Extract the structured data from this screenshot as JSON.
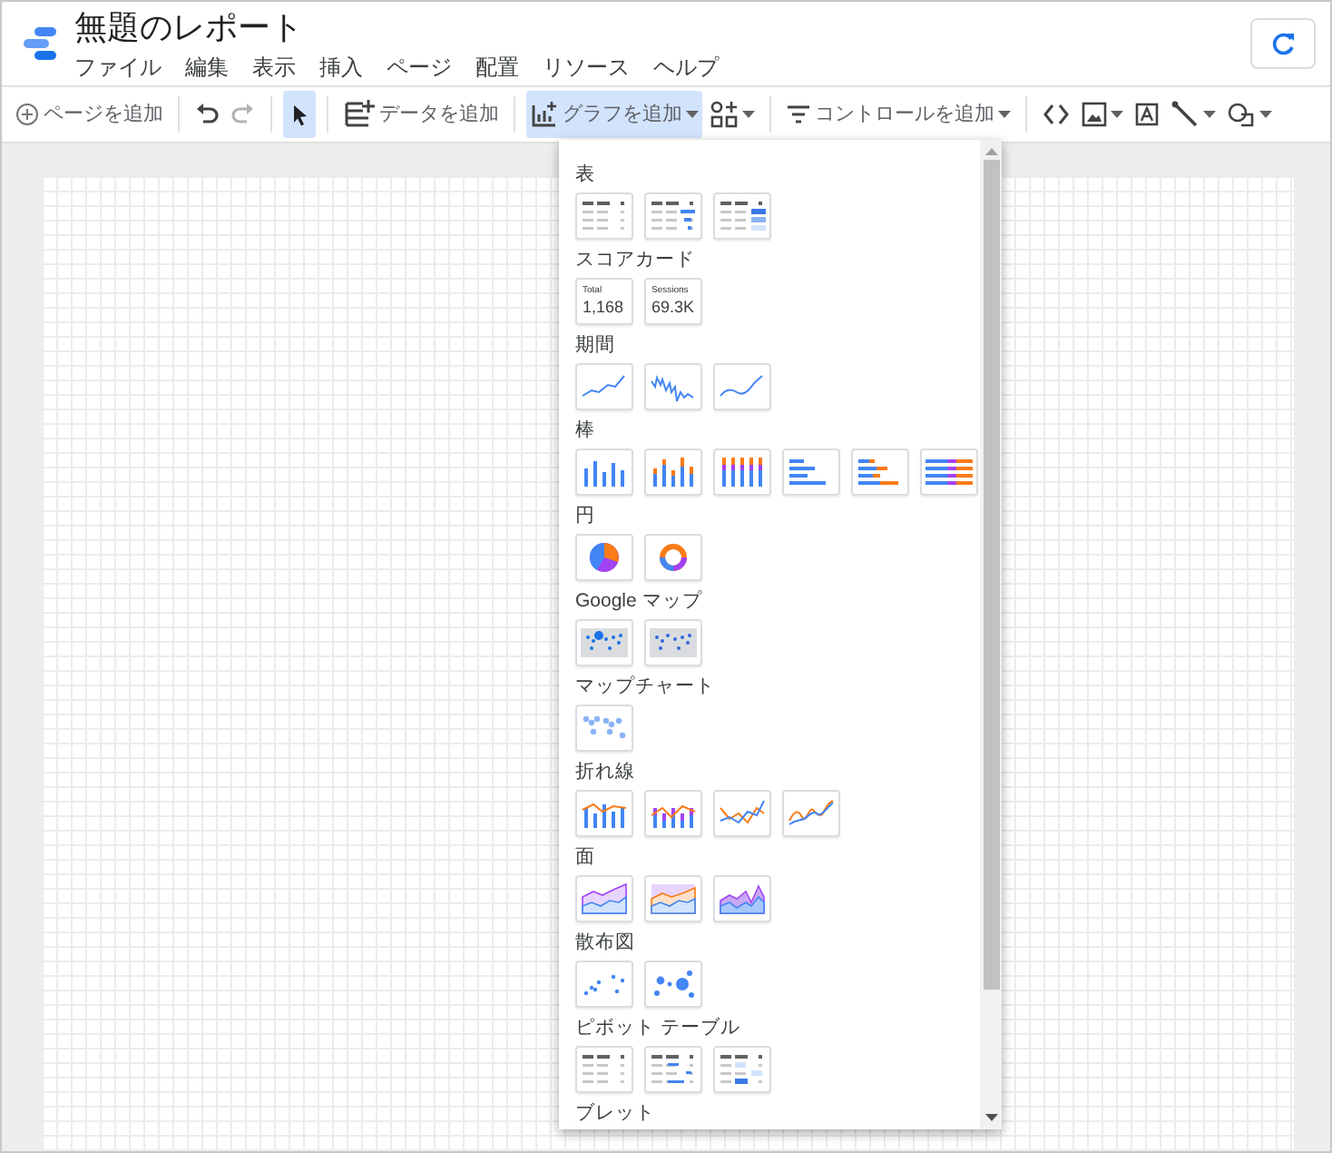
{
  "header": {
    "title": "無題のレポート",
    "menu": [
      "ファイル",
      "編集",
      "表示",
      "挿入",
      "ページ",
      "配置",
      "リソース",
      "ヘルプ"
    ]
  },
  "toolbar": [
    {
      "kind": "page",
      "label": "ページを追加",
      "selected": false,
      "disabled": false,
      "dropdown": false
    },
    {
      "kind": "undo",
      "selected": false,
      "disabled": false,
      "dropdown": false
    },
    {
      "kind": "redo",
      "selected": false,
      "disabled": true,
      "dropdown": false
    },
    {
      "kind": "pointer",
      "selected": true,
      "disabled": false,
      "dropdown": false
    },
    {
      "kind": "data",
      "label": "データを追加",
      "selected": false,
      "disabled": false,
      "dropdown": false
    },
    {
      "kind": "chart",
      "label": "グラフを追加",
      "selected": true,
      "disabled": false,
      "dropdown": true
    },
    {
      "kind": "community",
      "selected": false,
      "disabled": false,
      "dropdown": true
    },
    {
      "kind": "control",
      "label": "コントロールを追加",
      "selected": false,
      "disabled": false,
      "dropdown": true
    },
    {
      "kind": "embed",
      "selected": false,
      "disabled": false,
      "dropdown": false
    },
    {
      "kind": "image",
      "selected": false,
      "disabled": false,
      "dropdown": true
    },
    {
      "kind": "text",
      "selected": false,
      "disabled": false,
      "dropdown": false
    },
    {
      "kind": "line",
      "selected": false,
      "disabled": false,
      "dropdown": true
    },
    {
      "kind": "shape",
      "selected": false,
      "disabled": false,
      "dropdown": true
    }
  ],
  "chart_menu": {
    "sections": [
      {
        "label": "表",
        "options": [
          {
            "kind": "table"
          },
          {
            "kind": "tablebar"
          },
          {
            "kind": "heatmap"
          }
        ]
      },
      {
        "label": "スコアカード",
        "options": [
          {
            "kind": "scorecard",
            "caption": "Total",
            "value": "1,168"
          },
          {
            "kind": "scorecard",
            "caption": "Sessions",
            "value": "69.3K"
          }
        ]
      },
      {
        "label": "期間",
        "options": [
          {
            "kind": "trend"
          },
          {
            "kind": "noisy"
          },
          {
            "kind": "smooth"
          }
        ]
      },
      {
        "label": "棒",
        "options": [
          {
            "kind": "column"
          },
          {
            "kind": "stackedcolumn"
          },
          {
            "kind": "fullcolumn"
          },
          {
            "kind": "bar"
          },
          {
            "kind": "stackedbar"
          },
          {
            "kind": "fullbar"
          }
        ]
      },
      {
        "label": "円",
        "options": [
          {
            "kind": "pie"
          },
          {
            "kind": "donut"
          }
        ]
      },
      {
        "label": "Google マップ",
        "options": [
          {
            "kind": "bubblemap"
          },
          {
            "kind": "filledmap"
          }
        ]
      },
      {
        "label": "マップチャート",
        "options": [
          {
            "kind": "geomap"
          }
        ]
      },
      {
        "label": "折れ線",
        "options": [
          {
            "kind": "combo"
          },
          {
            "kind": "stackedcombo"
          },
          {
            "kind": "line"
          },
          {
            "kind": "smoothline"
          }
        ]
      },
      {
        "label": "面",
        "options": [
          {
            "kind": "area"
          },
          {
            "kind": "stackedarea"
          },
          {
            "kind": "fullarea"
          }
        ]
      },
      {
        "label": "散布図",
        "options": [
          {
            "kind": "scatter"
          },
          {
            "kind": "bubble"
          }
        ]
      },
      {
        "label": "ピボット テーブル",
        "options": [
          {
            "kind": "pivot"
          },
          {
            "kind": "pivotbar"
          },
          {
            "kind": "pivotheat"
          }
        ]
      },
      {
        "label": "ブレット"
      }
    ]
  }
}
